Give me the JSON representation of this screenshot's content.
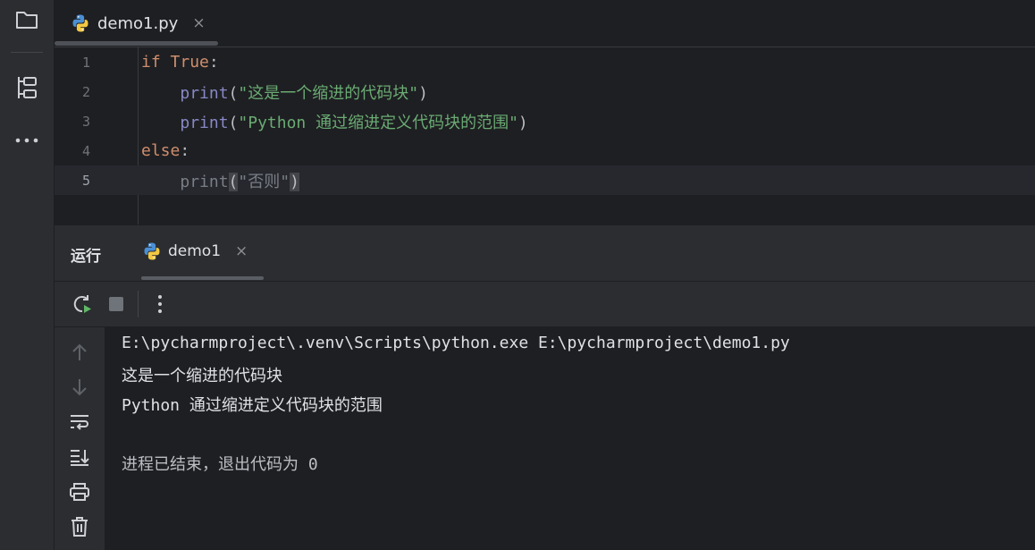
{
  "editor": {
    "tab": {
      "filename": "demo1.py",
      "close_glyph": "×"
    },
    "lines": [
      {
        "num": "1",
        "parts": [
          {
            "t": "if",
            "c": "kw"
          },
          {
            "t": " ",
            "c": "punc"
          },
          {
            "t": "True",
            "c": "kw"
          },
          {
            "t": ":",
            "c": "punc"
          }
        ]
      },
      {
        "num": "2",
        "parts": [
          {
            "t": "    ",
            "c": "punc"
          },
          {
            "t": "print",
            "c": "fn"
          },
          {
            "t": "(",
            "c": "punc"
          },
          {
            "t": "\"这是一个缩进的代码块\"",
            "c": "str"
          },
          {
            "t": ")",
            "c": "punc"
          }
        ]
      },
      {
        "num": "3",
        "parts": [
          {
            "t": "    ",
            "c": "punc"
          },
          {
            "t": "print",
            "c": "fn"
          },
          {
            "t": "(",
            "c": "punc"
          },
          {
            "t": "\"Python 通过缩进定义代码块的范围\"",
            "c": "str"
          },
          {
            "t": ")",
            "c": "punc"
          }
        ]
      },
      {
        "num": "4",
        "parts": [
          {
            "t": "else",
            "c": "kw"
          },
          {
            "t": ":",
            "c": "punc"
          }
        ]
      },
      {
        "num": "5",
        "parts": [
          {
            "t": "    ",
            "c": "punc"
          },
          {
            "t": "print",
            "c": "dim"
          },
          {
            "t": "(",
            "c": "bracehl"
          },
          {
            "t": "\"否则\"",
            "c": "dim"
          },
          {
            "t": ")",
            "c": "bracehl"
          }
        ]
      }
    ]
  },
  "run_panel": {
    "title": "运行",
    "tab_label": "demo1",
    "close_glyph": "×"
  },
  "console": {
    "command": "E:\\pycharmproject\\.venv\\Scripts\\python.exe E:\\pycharmproject\\demo1.py",
    "output_1": "这是一个缩进的代码块",
    "output_2": "Python 通过缩进定义代码块的范围",
    "exit_message": "进程已结束，退出代码为 0"
  },
  "colors": {
    "keyword": "#cf8e6d",
    "function": "#8888c6",
    "string": "#6aab73"
  }
}
